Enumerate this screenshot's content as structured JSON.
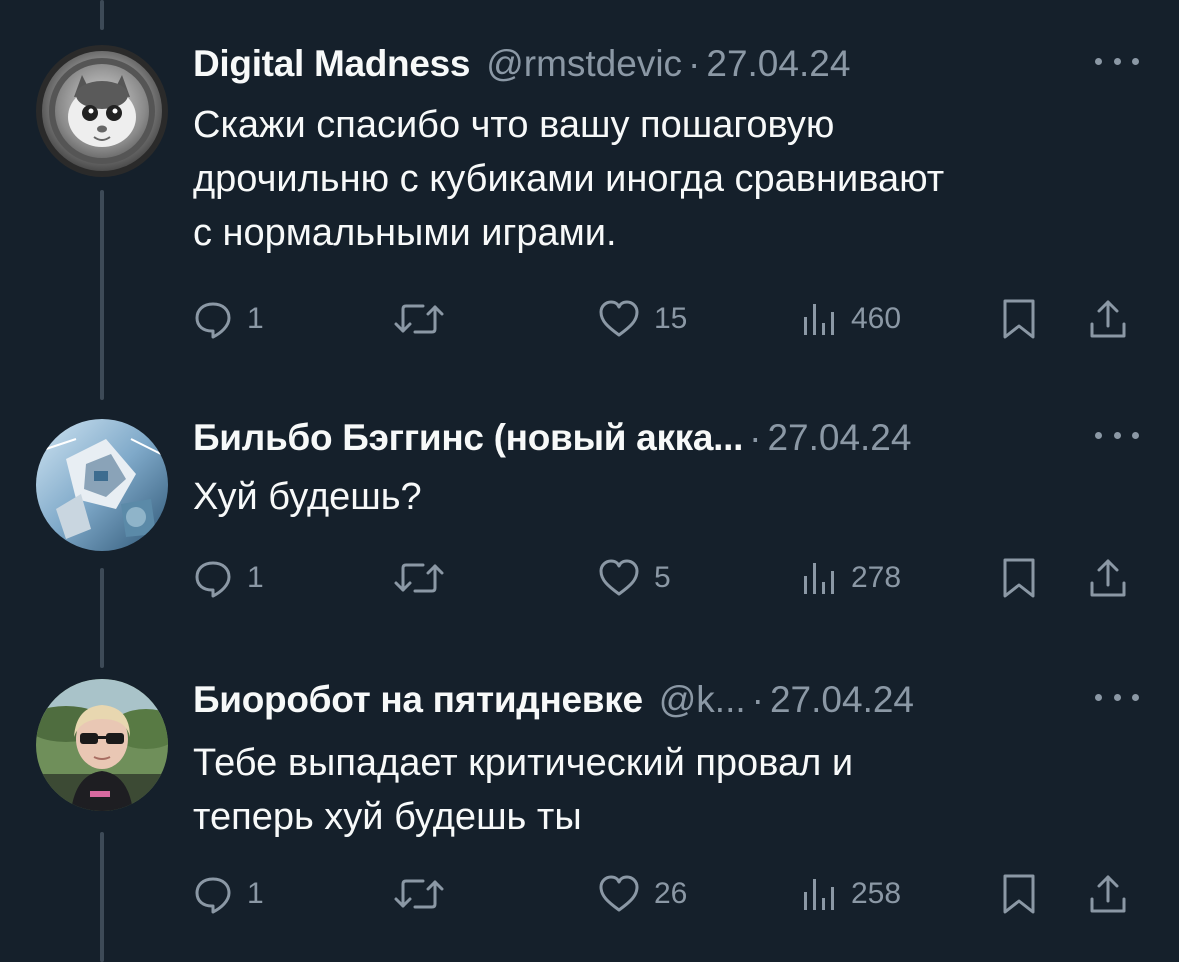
{
  "tweets": [
    {
      "name": "Digital Madness",
      "handle": "@rmstdevic",
      "dot": "·",
      "date": "27.04.24",
      "text": "Скажи спасибо что вашу пошаговую\nдрочильню с кубиками иногда сравнивают\nс нормальными играми.",
      "replies": "1",
      "likes": "15",
      "views": "460"
    },
    {
      "name": "Бильбо Бэггинс (новый акка...",
      "handle": "",
      "dot": "·",
      "date": "27.04.24",
      "text": "Хуй будешь?",
      "replies": "1",
      "likes": "5",
      "views": "278"
    },
    {
      "name": "Биоробот на пятидневке",
      "handle": "@k...",
      "dot": "·",
      "date": "27.04.24",
      "text": "Тебе выпадает критический провал и\nтеперь хуй будешь ты",
      "replies": "1",
      "likes": "26",
      "views": "258"
    }
  ],
  "icons": {
    "reply": "reply-icon",
    "retweet": "retweet-icon",
    "like": "heart-icon",
    "views": "views-icon",
    "bookmark": "bookmark-icon",
    "share": "share-icon",
    "more": "more-icon"
  },
  "colors": {
    "background": "#15202b",
    "text": "#f7f9f9",
    "secondary": "#8b98a5",
    "thread_line": "#3d4a57"
  }
}
